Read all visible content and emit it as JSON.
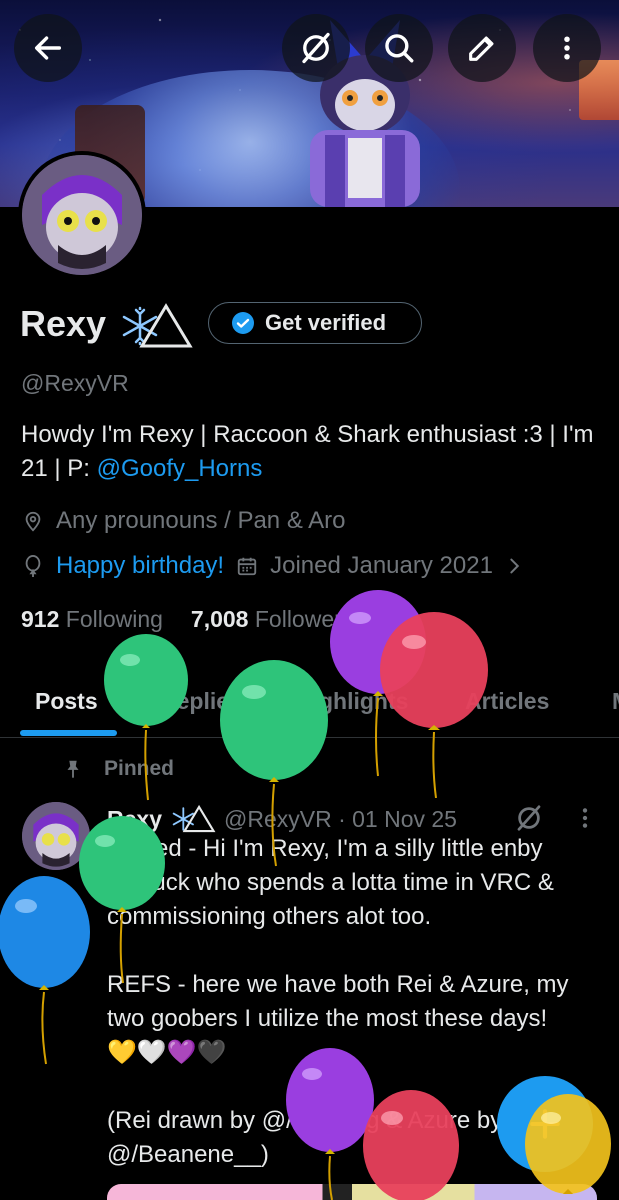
{
  "header": {
    "back_icon": "arrow-left-icon",
    "actions": [
      "grok-icon",
      "search-icon",
      "edit-icon",
      "more-icon"
    ]
  },
  "profile": {
    "name": "Rexy",
    "name_emoji": "❄️△",
    "verify_label": "Get verified",
    "handle": "@RexyVR",
    "bio_text": "Howdy I'm Rexy | Raccoon & Shark enthusiast :3 | I'm 21 | P: ",
    "bio_link": "@Goofy_Horns",
    "location": "Any prounouns / Pan & Aro",
    "birthday": "Happy birthday!",
    "joined": "Joined January 2021",
    "following_count": "912",
    "following_label": "Following",
    "followers_count": "7,008",
    "followers_label": "Followers"
  },
  "tabs": [
    {
      "label": "Posts",
      "active": true
    },
    {
      "label": "Replies",
      "active": false
    },
    {
      "label": "Highlights",
      "active": false
    },
    {
      "label": "Articles",
      "active": false
    },
    {
      "label": "M",
      "active": false
    }
  ],
  "pinned_post": {
    "pinned_label": "Pinned",
    "author": "Rexy",
    "author_emoji": "❄️△",
    "meta": "@RexyVR · 01 Nov 25",
    "body": "Pinned - Hi I'm Rexy, I'm a silly little enby shmuck who spends a lotta time in VRC & commissioning others alot too.\n\nREFS - here we have both Rei & Azure, my two goobers I utilize the most these days!\n💛🤍💜🖤\n\n(Rei drawn by @/ieapfr0g & Azure by @/Beanene__)"
  },
  "fab": {
    "icon": "plus-icon"
  },
  "colors": {
    "accent": "#1d9bf0",
    "text": "#e7e9ea",
    "muted": "#71767b",
    "background": "#000000"
  }
}
